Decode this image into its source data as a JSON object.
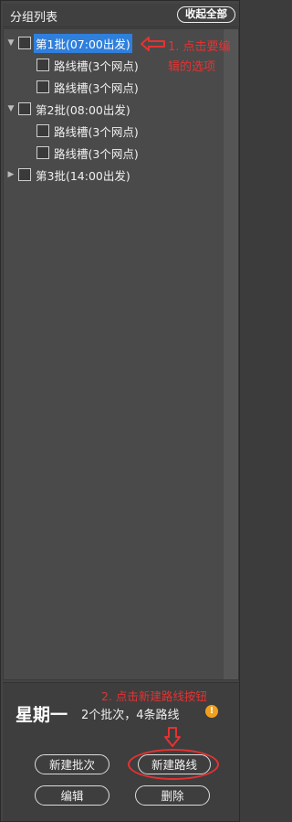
{
  "header": {
    "title": "分组列表",
    "collapse_all": "收起全部"
  },
  "tree": {
    "batch1": {
      "label": "第1批(07:00出发)",
      "expanded": true,
      "selected": true
    },
    "batch1_route1": {
      "label": "路线槽(3个网点)"
    },
    "batch1_route2": {
      "label": "路线槽(3个网点)"
    },
    "batch2": {
      "label": "第2批(08:00出发)",
      "expanded": true
    },
    "batch2_route1": {
      "label": "路线槽(3个网点)"
    },
    "batch2_route2": {
      "label": "路线槽(3个网点)"
    },
    "batch3": {
      "label": "第3批(14:00出发)",
      "expanded": false
    }
  },
  "annotations": {
    "step1": "1. 点击要编辑的选项",
    "step2": "2. 点击新建路线按钮",
    "color": "#e53232"
  },
  "bottom": {
    "weekday": "星期一",
    "summary": "2个批次，4条路线",
    "info_icon": "!"
  },
  "buttons": {
    "new_batch": "新建批次",
    "new_route": "新建路线",
    "edit": "编辑",
    "delete": "删除"
  },
  "colors": {
    "selection": "#2f7fdc",
    "info": "#f0a020"
  }
}
